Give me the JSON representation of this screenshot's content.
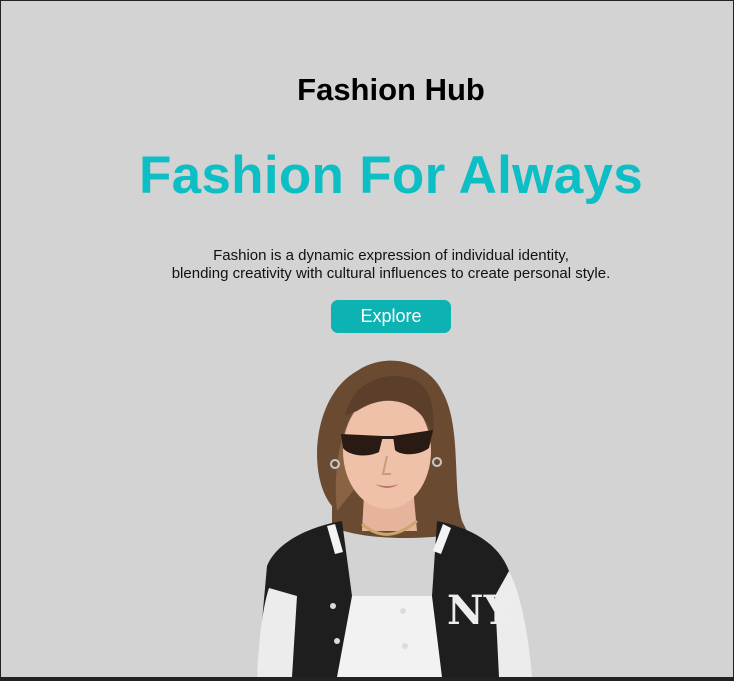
{
  "header": {
    "brand": "Fashion Hub"
  },
  "hero": {
    "headline": "Fashion For Always",
    "description_line1": "Fashion is a dynamic expression of individual identity,",
    "description_line2": "blending creativity with cultural influences to create personal style.",
    "cta_label": "Explore",
    "jacket_logo": "NY"
  },
  "colors": {
    "background": "#d3d3d3",
    "accent": "#0dbfc5",
    "button": "#0db3b3"
  }
}
